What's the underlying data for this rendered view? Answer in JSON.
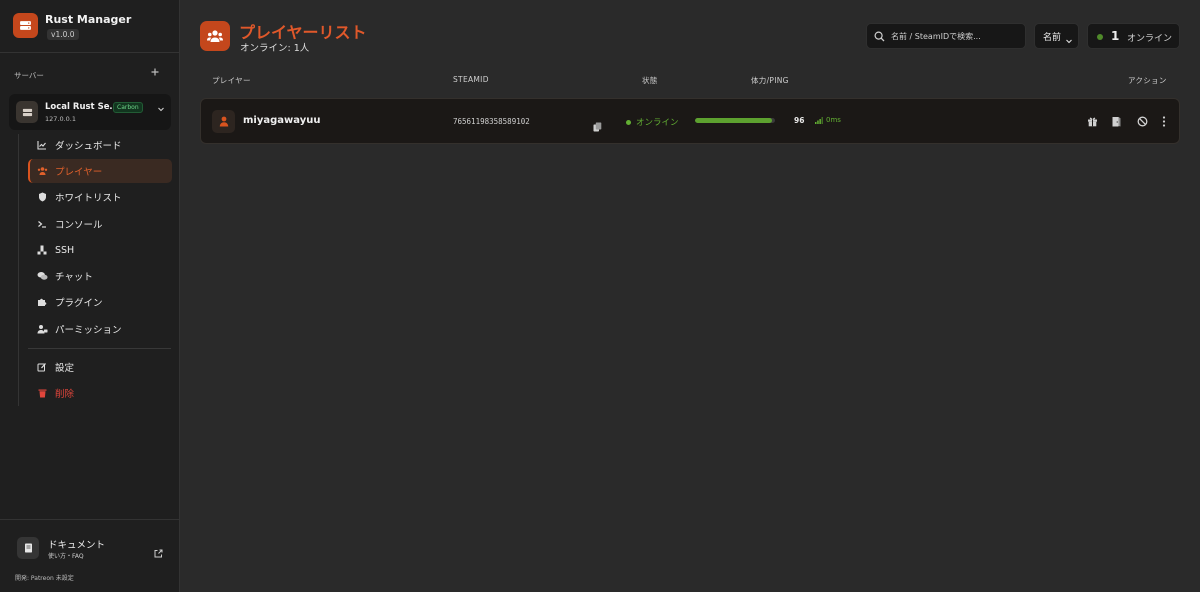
{
  "brand": {
    "title": "Rust Manager",
    "version": "v1.0.0"
  },
  "sidebar": {
    "servers_label": "サーバー",
    "server": {
      "name": "Local Rust Se…",
      "ip": "127.0.0.1",
      "badge": "Carbon"
    },
    "nav": [
      {
        "label": "ダッシュボード",
        "icon": "chart-line-icon"
      },
      {
        "label": "プレイヤー",
        "icon": "users-icon",
        "active": true
      },
      {
        "label": "ホワイトリスト",
        "icon": "shield-icon"
      },
      {
        "label": "コンソール",
        "icon": "terminal-icon"
      },
      {
        "label": "SSH",
        "icon": "network-icon"
      },
      {
        "label": "チャット",
        "icon": "chat-icon"
      },
      {
        "label": "プラグイン",
        "icon": "puzzle-icon"
      },
      {
        "label": "パーミッション",
        "icon": "user-lock-icon"
      },
      {
        "label": "設定",
        "icon": "edit-icon"
      },
      {
        "label": "削除",
        "icon": "trash-icon"
      }
    ],
    "docs": {
      "title": "ドキュメント",
      "subtitle": "使い方・FAQ"
    },
    "dev_note": "開発: Patreon 未設定"
  },
  "header": {
    "title": "プレイヤーリスト",
    "subtitle": "オンライン: 1人",
    "search_placeholder": "名前 / SteamIDで検索...",
    "sort_value": "名前",
    "online_count": "1",
    "online_label": "オンライン"
  },
  "table": {
    "columns": {
      "player": "プレイヤー",
      "steamid": "STEAMID",
      "status": "状態",
      "health_ping": "体力/PING",
      "actions": "アクション"
    },
    "rows": [
      {
        "name": "miyagawayuu",
        "steamid": "76561198358589102",
        "status": "オンライン",
        "health": 96,
        "health_label": "96",
        "ping": "0ms"
      }
    ]
  },
  "colors": {
    "accent": "#d9541f",
    "online": "#63b033",
    "danger": "#e0453b"
  }
}
